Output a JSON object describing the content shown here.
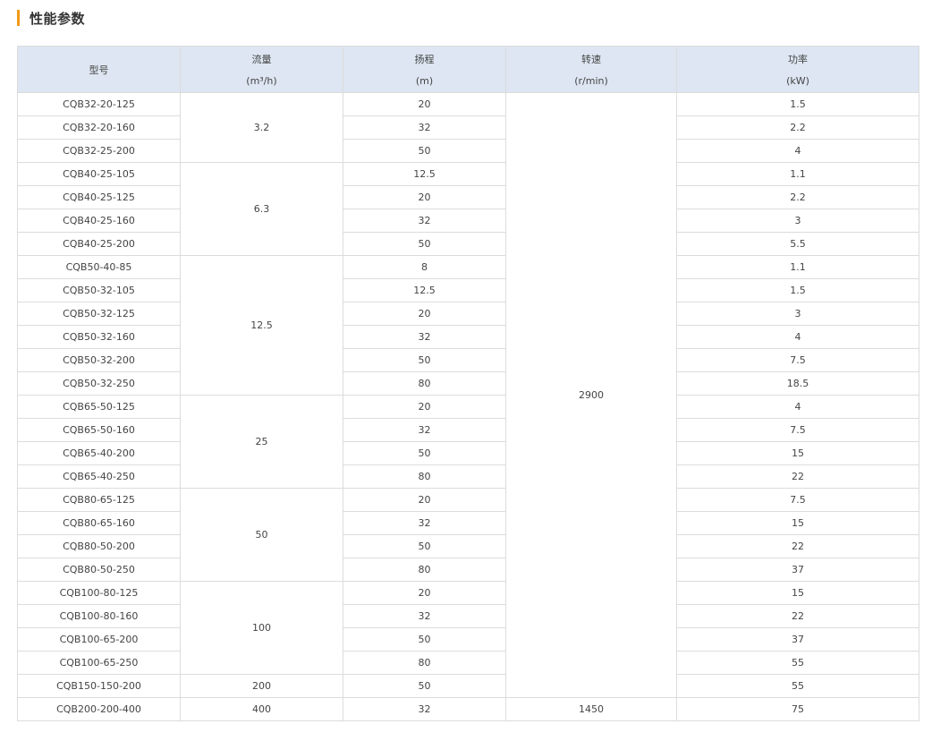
{
  "header": {
    "title": "性能参数",
    "accent_color": "#f39a17"
  },
  "table": {
    "header_bg": "#dde6f2",
    "columns": [
      {
        "name": "型号",
        "unit": ""
      },
      {
        "name": "流量",
        "unit": "(m³/h)"
      },
      {
        "name": "扬程",
        "unit": "(m)"
      },
      {
        "name": "转速",
        "unit": "(r/min)"
      },
      {
        "name": "功率",
        "unit": "(kW)"
      }
    ],
    "models": [
      "CQB32-20-125",
      "CQB32-20-160",
      "CQB32-25-200",
      "CQB40-25-105",
      "CQB40-25-125",
      "CQB40-25-160",
      "CQB40-25-200",
      "CQB50-40-85",
      "CQB50-32-105",
      "CQB50-32-125",
      "CQB50-32-160",
      "CQB50-32-200",
      "CQB50-32-250",
      "CQB65-50-125",
      "CQB65-50-160",
      "CQB65-40-200",
      "CQB65-40-250",
      "CQB80-65-125",
      "CQB80-65-160",
      "CQB80-50-200",
      "CQB80-50-250",
      "CQB100-80-125",
      "CQB100-80-160",
      "CQB100-65-200",
      "CQB100-65-250",
      "CQB150-150-200",
      "CQB200-200-400"
    ],
    "flow_groups": [
      {
        "value": "3.2",
        "rows": 3
      },
      {
        "value": "6.3",
        "rows": 4
      },
      {
        "value": "12.5",
        "rows": 6
      },
      {
        "value": "25",
        "rows": 4
      },
      {
        "value": "50",
        "rows": 4
      },
      {
        "value": "100",
        "rows": 4
      },
      {
        "value": "200",
        "rows": 1
      },
      {
        "value": "400",
        "rows": 1
      }
    ],
    "heads": [
      "20",
      "32",
      "50",
      "12.5",
      "20",
      "32",
      "50",
      "8",
      "12.5",
      "20",
      "32",
      "50",
      "80",
      "20",
      "32",
      "50",
      "80",
      "20",
      "32",
      "50",
      "80",
      "20",
      "32",
      "50",
      "80",
      "50",
      "32"
    ],
    "speed_groups": [
      {
        "value": "2900",
        "rows": 26
      },
      {
        "value": "1450",
        "rows": 1
      }
    ],
    "powers": [
      "1.5",
      "2.2",
      "4",
      "1.1",
      "2.2",
      "3",
      "5.5",
      "1.1",
      "1.5",
      "3",
      "4",
      "7.5",
      "18.5",
      "4",
      "7.5",
      "15",
      "22",
      "7.5",
      "15",
      "22",
      "37",
      "15",
      "22",
      "37",
      "55",
      "55",
      "75"
    ]
  }
}
